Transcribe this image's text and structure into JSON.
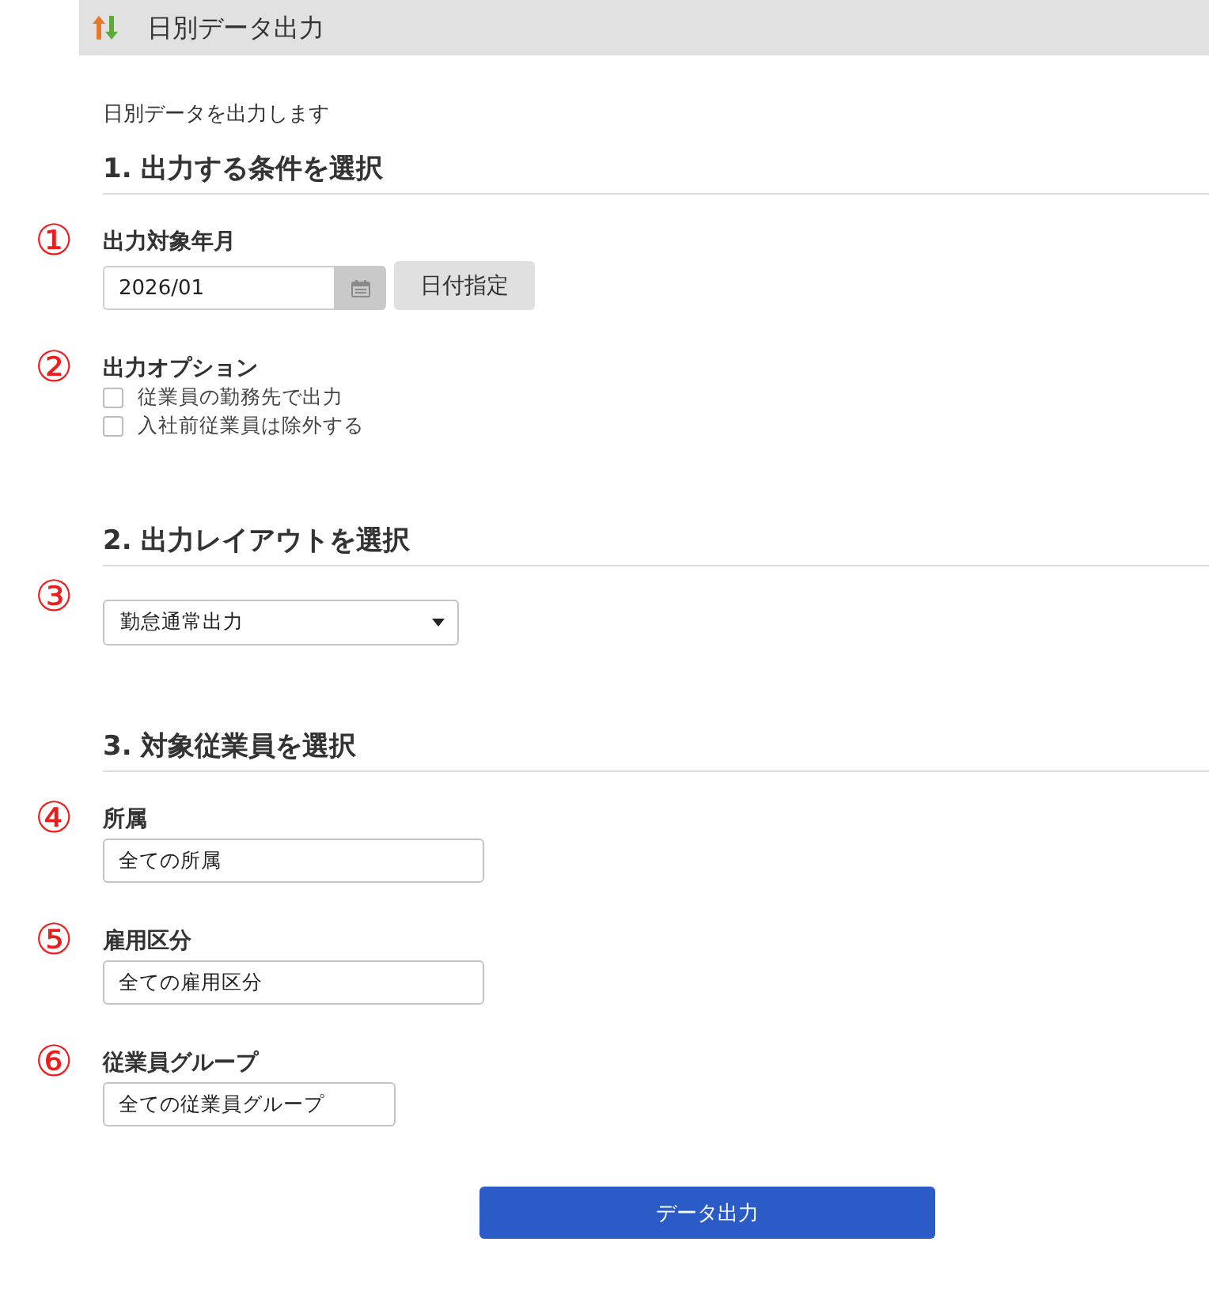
{
  "header": {
    "title": "日別データ出力"
  },
  "description": "日別データを出力します",
  "sections": [
    {
      "heading": "1. 出力する条件を選択",
      "items": [
        {
          "kind": "month",
          "marker": "①",
          "label": "出力対象年月",
          "value": "2026/01",
          "button": "日付指定"
        },
        {
          "kind": "checkboxes",
          "marker": "②",
          "label": "出力オプション",
          "options": [
            {
              "label": "従業員の勤務先で出力",
              "checked": false
            },
            {
              "label": "入社前従業員は除外する",
              "checked": false
            }
          ]
        }
      ]
    },
    {
      "heading": "2. 出力レイアウトを選択",
      "items": [
        {
          "kind": "select",
          "marker": "③",
          "value": "勤怠通常出力"
        }
      ]
    },
    {
      "heading": "3. 対象従業員を選択",
      "items": [
        {
          "kind": "text",
          "marker": "④",
          "label": "所属",
          "value": "全ての所属"
        },
        {
          "kind": "text",
          "marker": "⑤",
          "label": "雇用区分",
          "value": "全ての雇用区分"
        },
        {
          "kind": "text",
          "marker": "⑥",
          "label": "従業員グループ",
          "value": "全ての従業員グループ"
        }
      ]
    }
  ],
  "submit_button": "データ出力"
}
